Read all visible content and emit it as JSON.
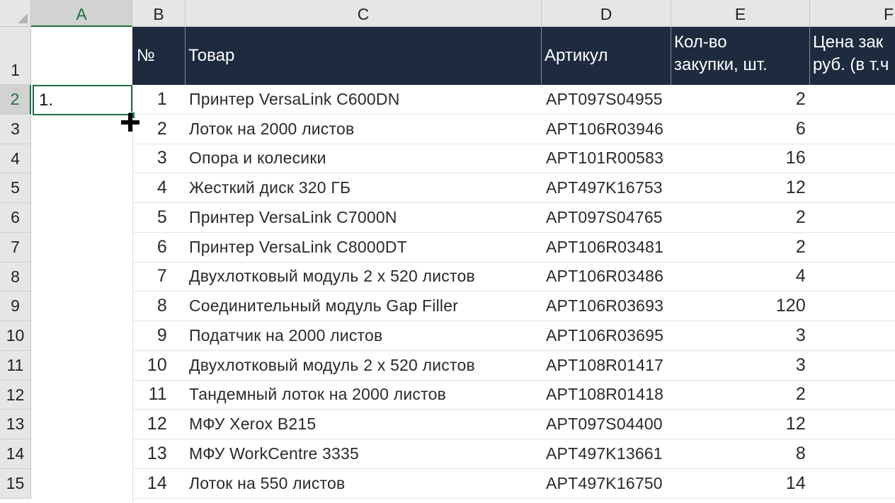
{
  "columns": [
    "A",
    "B",
    "C",
    "D",
    "E",
    "F"
  ],
  "row_numbers": [
    "1",
    "2",
    "3",
    "4",
    "5",
    "6",
    "7",
    "8",
    "9",
    "10",
    "11",
    "12",
    "13",
    "14",
    "15"
  ],
  "active_cell": {
    "value": "1."
  },
  "header": {
    "num": "№",
    "product": "Товар",
    "article": "Артикул",
    "qty_line1": "Кол-во",
    "qty_line2": "закупки, шт.",
    "price_line1": "Цена зак",
    "price_line2": "руб. (в т.ч"
  },
  "rows": [
    {
      "num": "1",
      "product": "Принтер VersaLink C600DN",
      "article": "APT097S04955",
      "qty": "2"
    },
    {
      "num": "2",
      "product": "Лоток на 2000 листов",
      "article": "APT106R03946",
      "qty": "6"
    },
    {
      "num": "3",
      "product": "Опора и колесики",
      "article": "APT101R00583",
      "qty": "16"
    },
    {
      "num": "4",
      "product": "Жесткий диск 320 ГБ",
      "article": "APT497K16753",
      "qty": "12"
    },
    {
      "num": "5",
      "product": "Принтер VersaLink C7000N",
      "article": "APT097S04765",
      "qty": "2"
    },
    {
      "num": "6",
      "product": "Принтер VersaLink C8000DT",
      "article": "APT106R03481",
      "qty": "2"
    },
    {
      "num": "7",
      "product": "Двухлотковый модуль 2 х 520 листов",
      "article": "APT106R03486",
      "qty": "4"
    },
    {
      "num": "8",
      "product": "Соединительный модуль Gap Filler",
      "article": "APT106R03693",
      "qty": "120"
    },
    {
      "num": "9",
      "product": "Податчик на 2000 листов",
      "article": "APT106R03695",
      "qty": "3"
    },
    {
      "num": "10",
      "product": "Двухлотковый модуль 2 х 520 листов",
      "article": "APT108R01417",
      "qty": "3"
    },
    {
      "num": "11",
      "product": "Тандемный лоток на 2000 листов",
      "article": "APT108R01418",
      "qty": "2"
    },
    {
      "num": "12",
      "product": "МФУ Xerox B215",
      "article": "APT097S04400",
      "qty": "12"
    },
    {
      "num": "13",
      "product": "МФУ WorkCentre 3335",
      "article": "APT497K13661",
      "qty": "8"
    },
    {
      "num": "14",
      "product": "Лоток на 550 листов",
      "article": "APT497K16750",
      "qty": "14"
    }
  ],
  "colors": {
    "header_band": "#1e2b3f",
    "selection": "#1f6e43"
  }
}
